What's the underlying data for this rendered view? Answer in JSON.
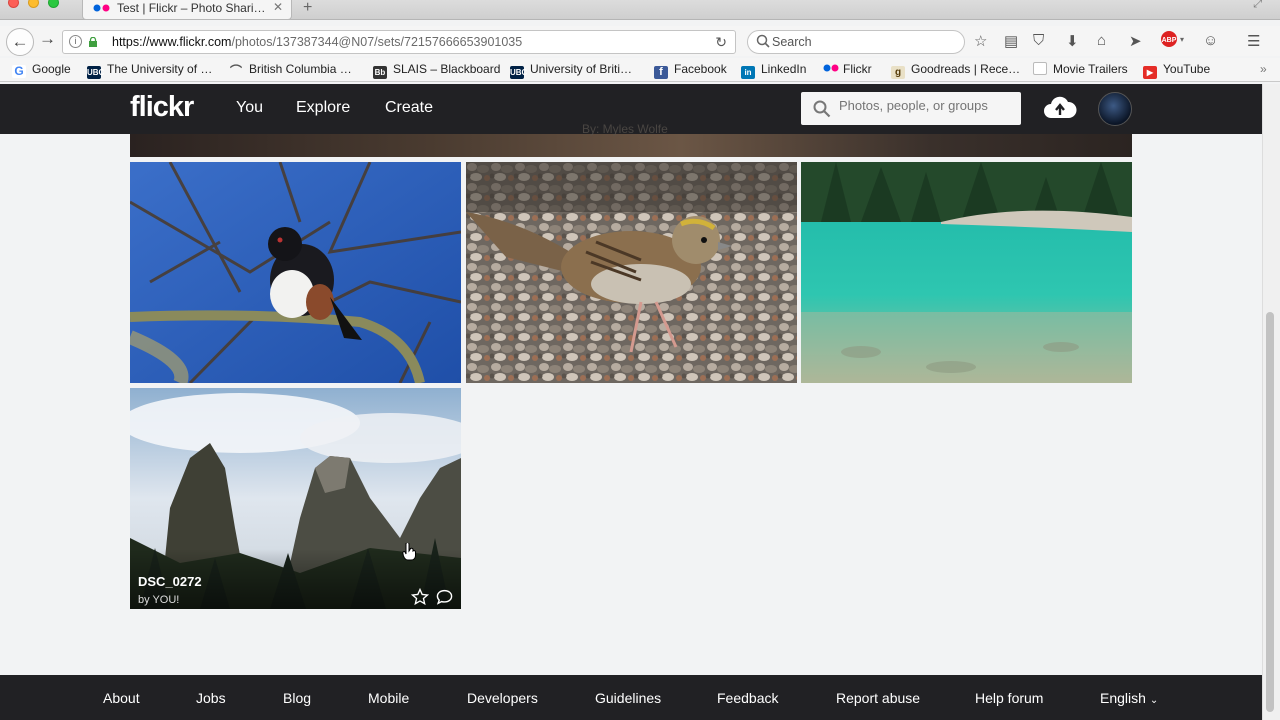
{
  "browser": {
    "tab_title": "Test | Flickr – Photo Shari…",
    "url_host": "https://www.flickr.com",
    "url_path": "/photos/137387344@N07/sets/72157666653901035",
    "search_placeholder": "Search",
    "bookmarks": [
      {
        "label": "Google",
        "icon": "google-icon",
        "color": "#4285f4"
      },
      {
        "label": "The University of …",
        "icon": "ubc-icon",
        "color": "#002145"
      },
      {
        "label": "British Columbia …",
        "icon": "bc-icon",
        "color": "#555555"
      },
      {
        "label": "SLAIS – Blackboard",
        "icon": "blackboard-icon",
        "color": "#333333"
      },
      {
        "label": "University of Briti…",
        "icon": "ubc-icon",
        "color": "#002145"
      },
      {
        "label": "Facebook",
        "icon": "facebook-icon",
        "color": "#3b5998"
      },
      {
        "label": "LinkedIn",
        "icon": "linkedin-icon",
        "color": "#0077b5"
      },
      {
        "label": "Flickr",
        "icon": "flickr-icon",
        "color": "#ff0084"
      },
      {
        "label": "Goodreads | Rece…",
        "icon": "goodreads-icon",
        "color": "#b7a46b"
      },
      {
        "label": "Movie Trailers",
        "icon": "page-icon",
        "color": "#cccccc"
      },
      {
        "label": "YouTube",
        "icon": "youtube-icon",
        "color": "#e52d27"
      }
    ]
  },
  "flickr": {
    "logo": "flickr",
    "nav": {
      "you": "You",
      "explore": "Explore",
      "create": "Create"
    },
    "search_placeholder": "Photos, people, or groups",
    "cover_credit": "By: Myles Wolfe",
    "photo": {
      "title": "DSC_0272",
      "byline": "by YOU!"
    }
  },
  "footer": {
    "about": "About",
    "jobs": "Jobs",
    "blog": "Blog",
    "mobile": "Mobile",
    "developers": "Developers",
    "guidelines": "Guidelines",
    "feedback": "Feedback",
    "report_abuse": "Report abuse",
    "help_forum": "Help forum",
    "language": "English"
  },
  "colors": {
    "flickr_bar": "#212124",
    "page_bg": "#f2f3f4",
    "flickr_pink": "#ff0084",
    "flickr_blue": "#0063dc"
  }
}
